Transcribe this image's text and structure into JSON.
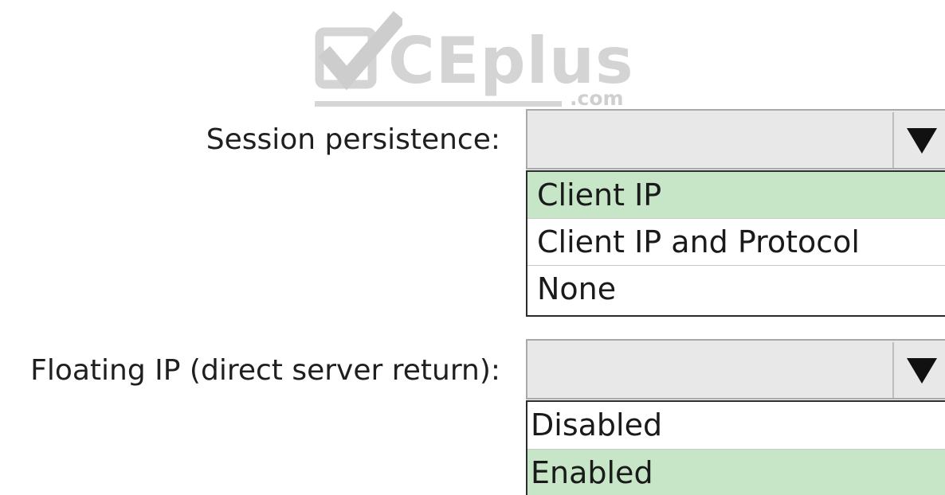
{
  "watermark": {
    "brand": "CEplus",
    "domain": ".com"
  },
  "session_persistence": {
    "label": "Session persistence:",
    "value": "",
    "options": [
      {
        "label": "Client IP",
        "selected": true
      },
      {
        "label": "Client IP and Protocol",
        "selected": false
      },
      {
        "label": "None",
        "selected": false
      }
    ]
  },
  "floating_ip": {
    "label": "Floating IP (direct server return):",
    "value": "",
    "options": [
      {
        "label": "Disabled",
        "selected": false
      },
      {
        "label": "Enabled",
        "selected": true
      }
    ]
  },
  "colors": {
    "selected_option": "#c7e6c7",
    "dropdown_fill": "#e8e8e8",
    "watermark": "#d4d4d4"
  },
  "icons": {
    "dropdown_arrow": "triangle-down-icon",
    "watermark_mark": "checkmark-icon"
  }
}
